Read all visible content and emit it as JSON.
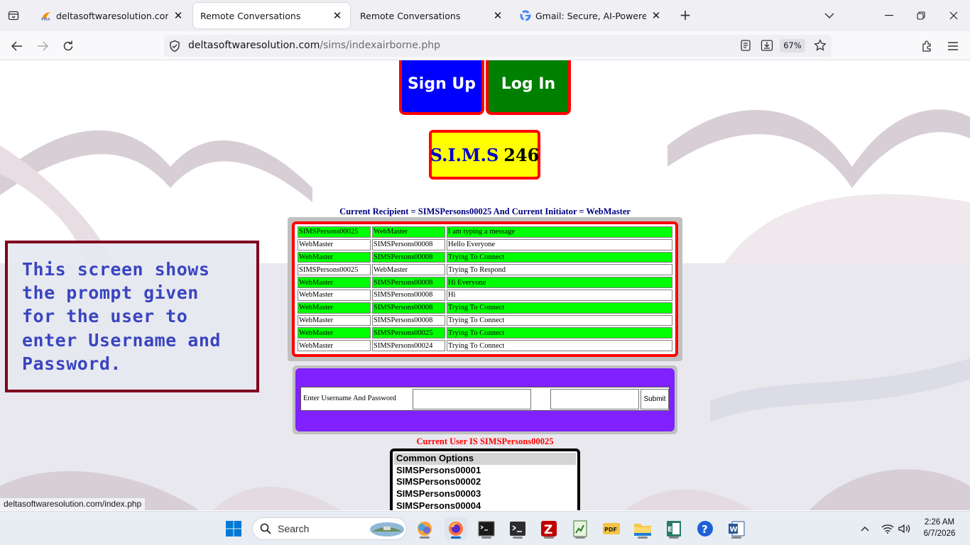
{
  "browser": {
    "tabs": [
      {
        "title": "deltasoftwaresolution.com / loc",
        "favicon": "phpmyadmin-icon"
      },
      {
        "title": "Remote Conversations",
        "favicon": ""
      },
      {
        "title": "Remote Conversations",
        "favicon": ""
      },
      {
        "title": "Gmail: Secure, AI-Powered Emai",
        "favicon": "google-icon"
      }
    ],
    "active_tab_index": 1,
    "url_host": "deltasoftwaresolution.com",
    "url_path": "/sims/indexairborne.php",
    "zoom": "67%"
  },
  "page": {
    "signup_label": "Sign Up",
    "login_label": "Log In",
    "sims_name": "S.I.M.S",
    "sims_number": "246",
    "recipient_line": "Current Recipient = SIMSPersons00025 And Current Initiator = WebMaster",
    "messages": [
      {
        "from": "SIMSPersons00025",
        "to": "WebMaster",
        "text": "I am typing a message",
        "highlight": true
      },
      {
        "from": "WebMaster",
        "to": "SIMSPersons00008",
        "text": "Hello Everyone",
        "highlight": false
      },
      {
        "from": "WebMaster",
        "to": "SIMSPersons00008",
        "text": "Trying To Connect",
        "highlight": true
      },
      {
        "from": "SIMSPersons00025",
        "to": "WebMaster",
        "text": "Trying To Respond",
        "highlight": false
      },
      {
        "from": "WebMaster",
        "to": "SIMSPersons00008",
        "text": "Hi Everyone",
        "highlight": true
      },
      {
        "from": "WebMaster",
        "to": "SIMSPersons00008",
        "text": "Hi",
        "highlight": false
      },
      {
        "from": "WebMaster",
        "to": "SIMSPersons00008",
        "text": "Trying To Connect",
        "highlight": true
      },
      {
        "from": "WebMaster",
        "to": "SIMSPersons00008",
        "text": "Trying To Connect",
        "highlight": false
      },
      {
        "from": "WebMaster",
        "to": "SIMSPersons00025",
        "text": "Trying To Connect",
        "highlight": true
      },
      {
        "from": "WebMaster",
        "to": "SIMSPersons00024",
        "text": "Trying To Connect",
        "highlight": false
      }
    ],
    "login": {
      "label": "Enter Username And Password",
      "username_value": "",
      "password_value": "",
      "submit_label": "Submit"
    },
    "current_user_line": "Current User IS SIMSPersons00025",
    "options": [
      "Common Options",
      "SIMSPersons00001",
      "SIMSPersons00002",
      "SIMSPersons00003",
      "SIMSPersons00004"
    ],
    "annotation": "This screen shows the prompt given for the user to enter Username and Password.",
    "status_link": "deltasoftwaresolution.com/index.php"
  },
  "taskbar": {
    "search_label": "Search",
    "time": "2:26 AM",
    "date": "6/7/2026"
  },
  "colors": {
    "signup_bg": "#0000ff",
    "login_bg": "#008000",
    "border_red": "#ff0000",
    "sims_bg": "#ffff00",
    "row_green": "#00ff00",
    "login_panel": "#7f22ff",
    "annotation_text": "#3a45c0",
    "annotation_border": "#800020"
  }
}
